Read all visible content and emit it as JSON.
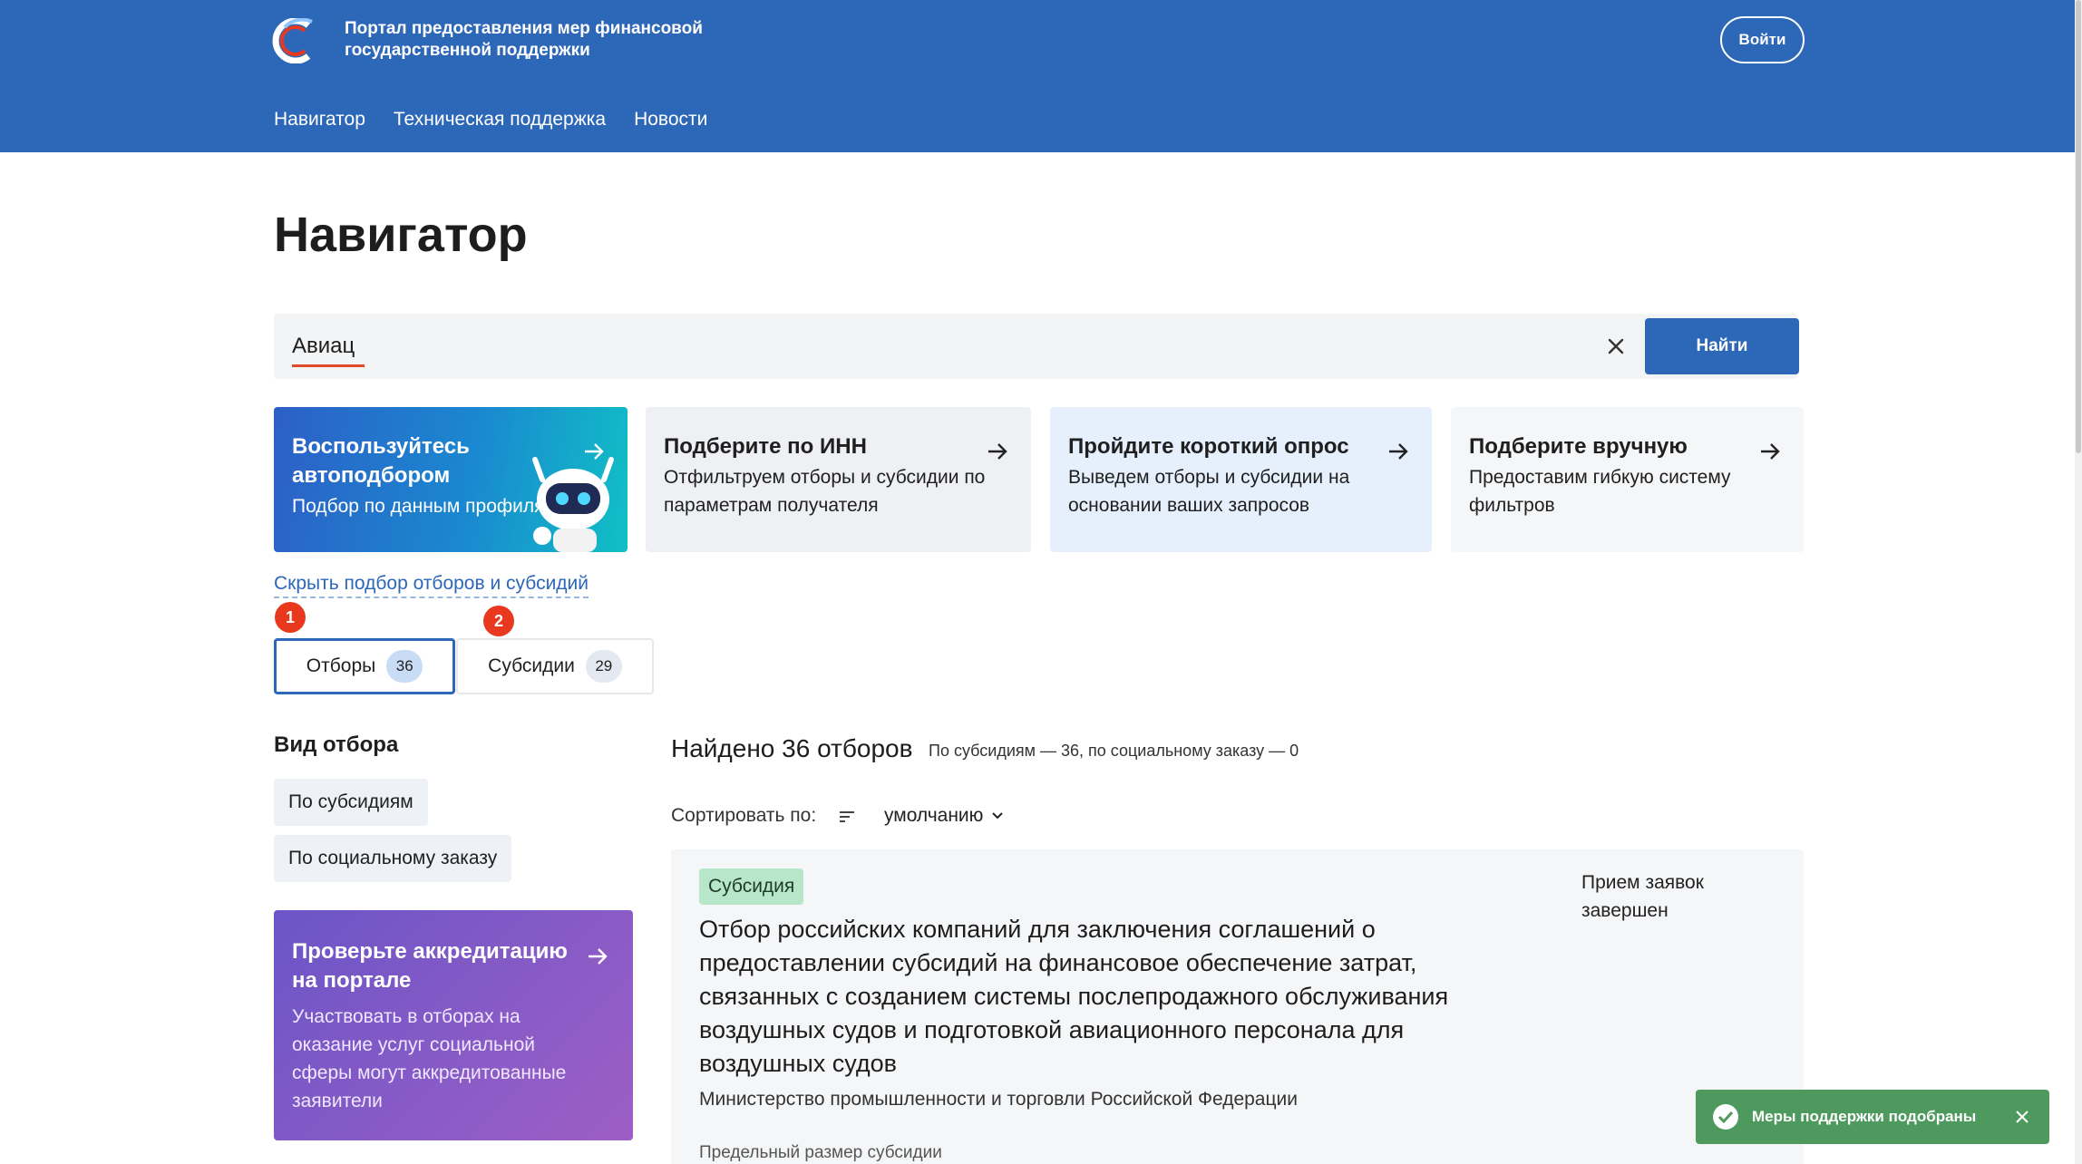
{
  "header": {
    "portal_title": "Портал предоставления мер финансовой государственной поддержки",
    "login_label": "Войти",
    "nav": [
      "Навигатор",
      "Техническая поддержка",
      "Новости"
    ],
    "colors": {
      "brand": "#2d67b8",
      "accent_red": "#e8391f"
    }
  },
  "page": {
    "title": "Навигатор"
  },
  "search": {
    "value": "Авиац",
    "button_label": "Найти"
  },
  "cards": [
    {
      "title": "Воспользуйтесь автоподбором",
      "subtitle": "Подбор по данным профиля"
    },
    {
      "title": "Подберите по ИНН",
      "subtitle": "Отфильтруем отборы и субсидии по параметрам получателя"
    },
    {
      "title": "Пройдите короткий опрос",
      "subtitle": "Выведем отборы и субсидии на основании ваших запросов"
    },
    {
      "title": "Подберите вручную",
      "subtitle": "Предоставим гибкую систему фильтров"
    }
  ],
  "hide_link": "Скрыть подбор отборов и субсидий",
  "tabs": [
    {
      "label": "Отборы",
      "count": "36",
      "marker": "1"
    },
    {
      "label": "Субсидии",
      "count": "29",
      "marker": "2"
    }
  ],
  "filters": {
    "title": "Вид отбора",
    "chips": [
      "По субсидиям",
      "По социальному заказу"
    ]
  },
  "accreditation": {
    "title": "Проверьте аккредитацию на портале",
    "text": "Участвовать в отборах на оказание услуг социальной сферы могут аккредитованные заявители"
  },
  "results": {
    "title": "Найдено 36 отборов",
    "summary": "По субсидиям — 36, по социальному заказу — 0",
    "sort_label": "Сортировать по:",
    "sort_value": "умолчанию",
    "items": [
      {
        "badge": "Субсидия",
        "title": "Отбор российских компаний для заключения соглашений о предоставлении субсидий на финансовое обеспечение затрат, связанных с созданием системы послепродажного обслуживания воздушных судов и подготовкой авиационного персонала для воздушных судов",
        "org": "Министерство промышленности и торговли Российской Федерации",
        "status": "Прием заявок завершен",
        "limit_label": "Предельный размер субсидии"
      }
    ]
  },
  "toast": {
    "message": "Меры поддержки подобраны"
  }
}
